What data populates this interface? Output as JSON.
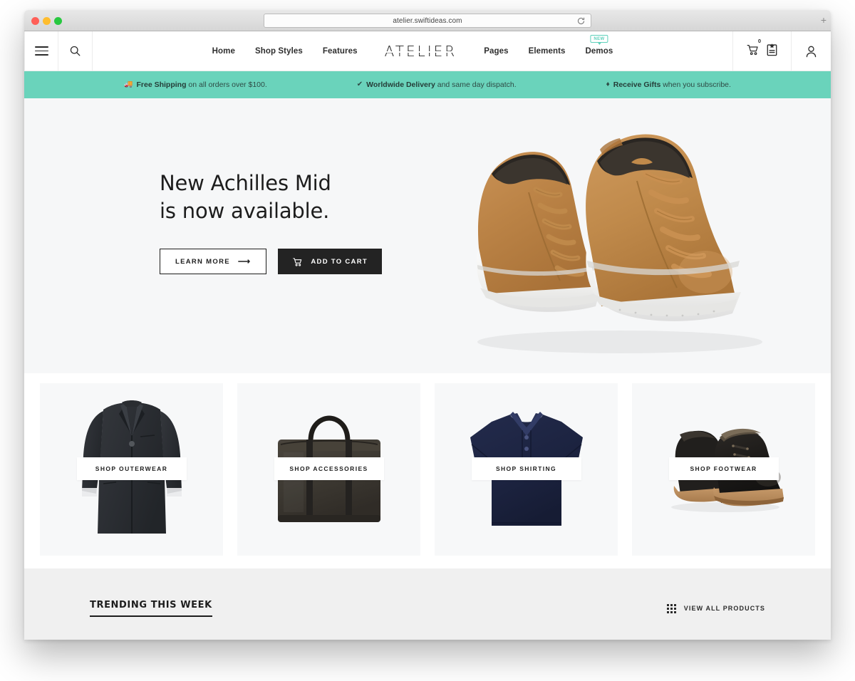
{
  "browser": {
    "url": "atelier.swiftideas.com",
    "reload_icon": "reload-icon",
    "new_tab_label": "+",
    "traffic_lights": [
      "close",
      "minimize",
      "maximize"
    ]
  },
  "header": {
    "menu_icon": "hamburger-menu-icon",
    "search_icon": "search-icon",
    "brand": "ATELIER",
    "nav_left": [
      {
        "label": "Home"
      },
      {
        "label": "Shop Styles"
      },
      {
        "label": "Features"
      }
    ],
    "nav_right": [
      {
        "label": "Pages"
      },
      {
        "label": "Elements"
      },
      {
        "label": "Demos",
        "badge": "NEW"
      }
    ],
    "cart_icon": "shopping-cart-icon",
    "cart_count": "0",
    "wishlist_icon": "wishlist-clipboard-icon",
    "account_icon": "user-account-icon"
  },
  "promo": {
    "background": "#6ad3bb",
    "items": [
      {
        "icon": "truck-icon",
        "glyph": "🚚",
        "strong": "Free Shipping",
        "rest": " on all orders over $100."
      },
      {
        "icon": "check-icon",
        "glyph": "✔",
        "strong": "Worldwide Delivery",
        "rest": " and same day dispatch."
      },
      {
        "icon": "gift-diamond-icon",
        "glyph": "♦",
        "strong": "Receive Gifts",
        "rest": " when you subscribe."
      }
    ]
  },
  "hero": {
    "title_line1": "New Achilles Mid",
    "title_line2": "is now available.",
    "primary_button": "LEARN MORE",
    "primary_arrow": "arrow-right-icon",
    "secondary_button": "ADD TO CART",
    "secondary_icon": "add-to-cart-icon",
    "product_image": "tan-suede-high-top-sneakers",
    "background": "#f6f7f8"
  },
  "categories": [
    {
      "label": "SHOP OUTERWEAR",
      "art": "charcoal-wool-overcoat",
      "color": "#2e3034"
    },
    {
      "label": "SHOP ACCESSORIES",
      "art": "dark-brown-briefcase-bag",
      "color": "#44403a"
    },
    {
      "label": "SHOP SHIRTING",
      "art": "navy-polo-shirt",
      "color": "#1d2440"
    },
    {
      "label": "SHOP FOOTWEAR",
      "art": "black-leather-boots",
      "color": "#1c1a1a"
    }
  ],
  "trending": {
    "title": "TRENDING THIS WEEK",
    "view_all_label": "VIEW ALL PRODUCTS",
    "view_all_icon": "grid-icon",
    "background": "#f0f0f0"
  }
}
